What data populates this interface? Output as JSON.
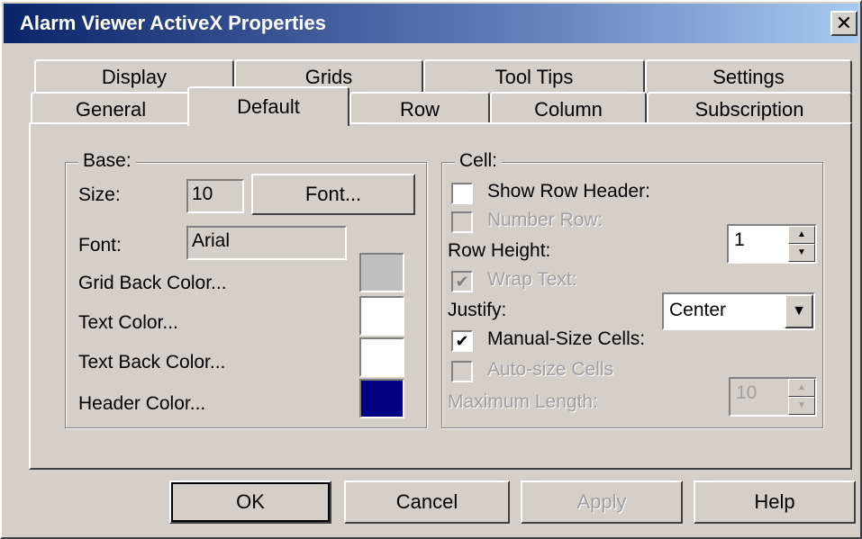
{
  "window": {
    "title": "Alarm Viewer  ActiveX Properties",
    "close_glyph": "✕"
  },
  "tabs": {
    "row1": [
      "Display",
      "Grids",
      "Tool Tips",
      "Settings"
    ],
    "row2": [
      "General",
      "Default",
      "Row",
      "Column",
      "Subscription"
    ],
    "active": "Default"
  },
  "base": {
    "legend": "Base:",
    "size_label": "Size:",
    "size_value": "10",
    "font_button": "Font...",
    "font_label": "Font:",
    "font_value": "Arial",
    "grid_back_color_label": "Grid Back Color...",
    "text_color_label": "Text Color...",
    "text_back_color_label": "Text Back Color...",
    "header_color_label": "Header Color...",
    "colors": {
      "grid_back": "#c0c0c0",
      "text": "#ffffff",
      "text_back": "#ffffff",
      "header": "#000080"
    }
  },
  "cell": {
    "legend": "Cell:",
    "show_row_header_label": "Show Row Header:",
    "show_row_header_checked": false,
    "number_row_label": "Number Row:",
    "number_row_checked": false,
    "row_height_label": "Row Height:",
    "row_height_value": "1",
    "wrap_text_label": "Wrap Text:",
    "wrap_text_checked": true,
    "justify_label": "Justify:",
    "justify_value": "Center",
    "manual_size_label": "Manual-Size Cells:",
    "manual_size_checked": true,
    "auto_size_label": "Auto-size Cells",
    "auto_size_checked": false,
    "max_length_label": "Maximum Length:",
    "max_length_value": "10"
  },
  "buttons": {
    "ok": "OK",
    "cancel": "Cancel",
    "apply": "Apply",
    "help": "Help"
  },
  "glyphs": {
    "check": "✔",
    "arrow_up": "▲",
    "arrow_down": "▼"
  }
}
